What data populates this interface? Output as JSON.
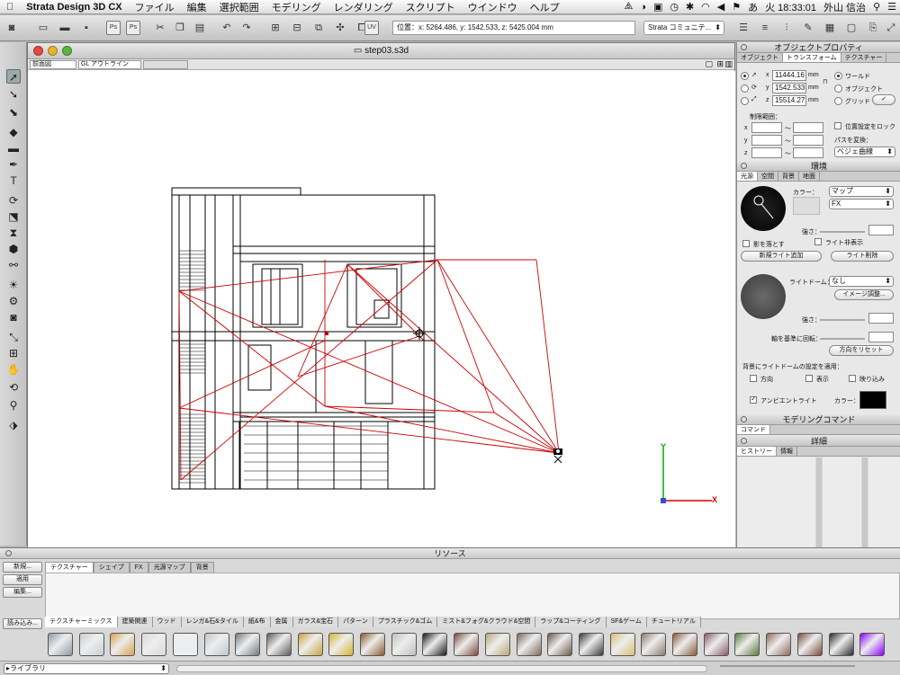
{
  "menubar": {
    "app": "Strata Design 3D CX",
    "items": [
      "ファイル",
      "編集",
      "選択範囲",
      "モデリング",
      "レンダリング",
      "スクリプト",
      "ウインドウ",
      "ヘルプ"
    ],
    "clock": "火 18:33:01",
    "user": "外山 信治"
  },
  "toolbar": {
    "coords": "位置：x: 5264.486, y: 1542.533, z: 5425.004 mm",
    "community": "Strata コミュニテ...",
    "box_labels": [
      "Ps",
      "Ps",
      "UV"
    ]
  },
  "document": {
    "title": "step03.s3d",
    "view": "前面図",
    "render_mode": "GL アウトライン"
  },
  "axes": {
    "y_label": "Y",
    "x_label": "X"
  },
  "object_props": {
    "title": "オブジェクトプロパティ",
    "tabs": [
      "オブジェクト",
      "トランスフォーム",
      "テクスチャー"
    ],
    "x": "11444.16",
    "y": "1542.533",
    "z": "15514.27",
    "unit": "mm",
    "coord_options": [
      "ワールド",
      "オブジェクト",
      "グリッド"
    ],
    "limit_label": "制限範囲：",
    "axis_x": "x",
    "axis_y": "y",
    "axis_z": "z",
    "tilde": "〜",
    "lock_label": "位置設定をロック",
    "path_label": "パスを変換：",
    "path_value": "ベジェ曲線"
  },
  "environment": {
    "title": "環境",
    "tabs": [
      "光源",
      "空間",
      "背景",
      "地面"
    ],
    "color_label": "カラー：",
    "map_value": "マップ",
    "fx_value": "FX",
    "strength_label": "強さ：",
    "shadow_label": "影を落とす",
    "hide_light_label": "ライト非表示",
    "add_light": "新規ライト追加",
    "delete_light": "ライト削除",
    "light_dome_label": "ライトドーム：",
    "light_dome_value": "なし",
    "image_adjust": "イメージ調整...",
    "strength2_label": "強さ：",
    "rotate_label": "軸を基準に回転：",
    "reset_dir": "方向をリセット",
    "apply_label": "背景にライトドームの設定を適用：",
    "apply_opts": [
      "方向",
      "表示",
      "映り込み"
    ],
    "ambient_label": "アンビエントライト",
    "ambient_color_label": "カラー："
  },
  "modeling": {
    "title": "モデリングコマンド",
    "tab": "コマンド"
  },
  "detail": {
    "title": "詳細",
    "tabs": [
      "ヒストリー",
      "情報"
    ]
  },
  "resources": {
    "title": "リソース",
    "buttons": [
      "新規...",
      "適用",
      "編集...",
      "読み込み..."
    ],
    "tabs": [
      "テクスチャー",
      "シェイプ",
      "FX",
      "光源マップ",
      "背景"
    ],
    "categories": [
      "テクスチャーミックス",
      "建築関連",
      "ウッド",
      "レンガ&石&タイル",
      "紙&布",
      "金属",
      "ガラス&宝石",
      "パターン",
      "プラスチック&ゴム",
      "ミスト&フォグ&クラウド&空間",
      "ラップ&コーティング",
      "SF&ゲーム",
      "チュートリアル"
    ],
    "library_label": "▸ライブラリ",
    "swatch_colors": [
      "#8f9aa3",
      "#c9cfd6",
      "#d8a24c",
      "#d9d9d9",
      "#e7eef5",
      "#bcc7d0",
      "#6f7a83",
      "#5a5a5a",
      "#c9a23c",
      "#d4b52c",
      "#8a5a2a",
      "#c0c0c0",
      "#1a1a1a",
      "#7a4a3a",
      "#b8a878",
      "#7a6a5a",
      "#6a5a4a",
      "#3a3a3a",
      "#d8c070",
      "#8a7a6a",
      "#8a5a3a",
      "#8a5a6a",
      "#5a7a3a",
      "#8a6a5a",
      "#7a4a3a",
      "#2a2a2a",
      "#8a00ff"
    ]
  },
  "colors": {
    "accent": "#d00000",
    "axis_y": "#00aa00",
    "axis_x": "#d00000"
  }
}
